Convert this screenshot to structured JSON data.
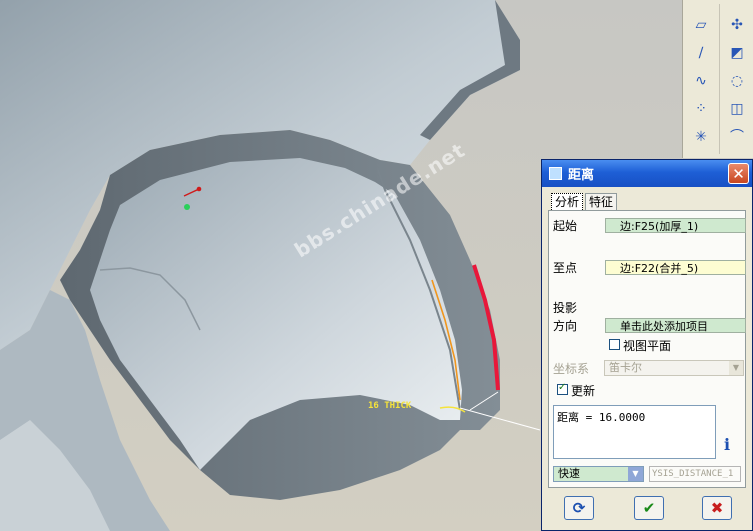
{
  "viewport": {
    "watermark": "bbs.chinade.net",
    "annotation": "16 THICK"
  },
  "toolbar": {
    "icons": [
      "datum-plane-icon",
      "datum-axis-icon",
      "sketch-curve-icon",
      "datum-point-icon",
      "coord-system-icon",
      "fill-icon",
      "sweep-icon",
      "surface-icon"
    ]
  },
  "dialog": {
    "title": "距离",
    "close_label": "✕",
    "tabs": [
      {
        "label": "分析"
      },
      {
        "label": "特征"
      }
    ],
    "from_label": "起始",
    "from_value": "边:F25(加厚_1)",
    "to_label": "至点",
    "to_value": "边:F22(合并_5)",
    "projection_label": "投影",
    "direction_label": "方向",
    "direction_value": "单击此处添加项目",
    "view_plane_label": "视图平面",
    "view_plane_checked": false,
    "coord_label": "坐标系",
    "coord_value": "笛卡尔",
    "update_label": "更新",
    "update_checked": true,
    "result": "距离 = 16.0000",
    "mode_value": "快速",
    "name_value": "YSIS_DISTANCE_1",
    "colors": {
      "accent_green": "#cfe9cf",
      "title_blue": "#1e5fd6",
      "highlight_red": "#e8173a"
    }
  }
}
